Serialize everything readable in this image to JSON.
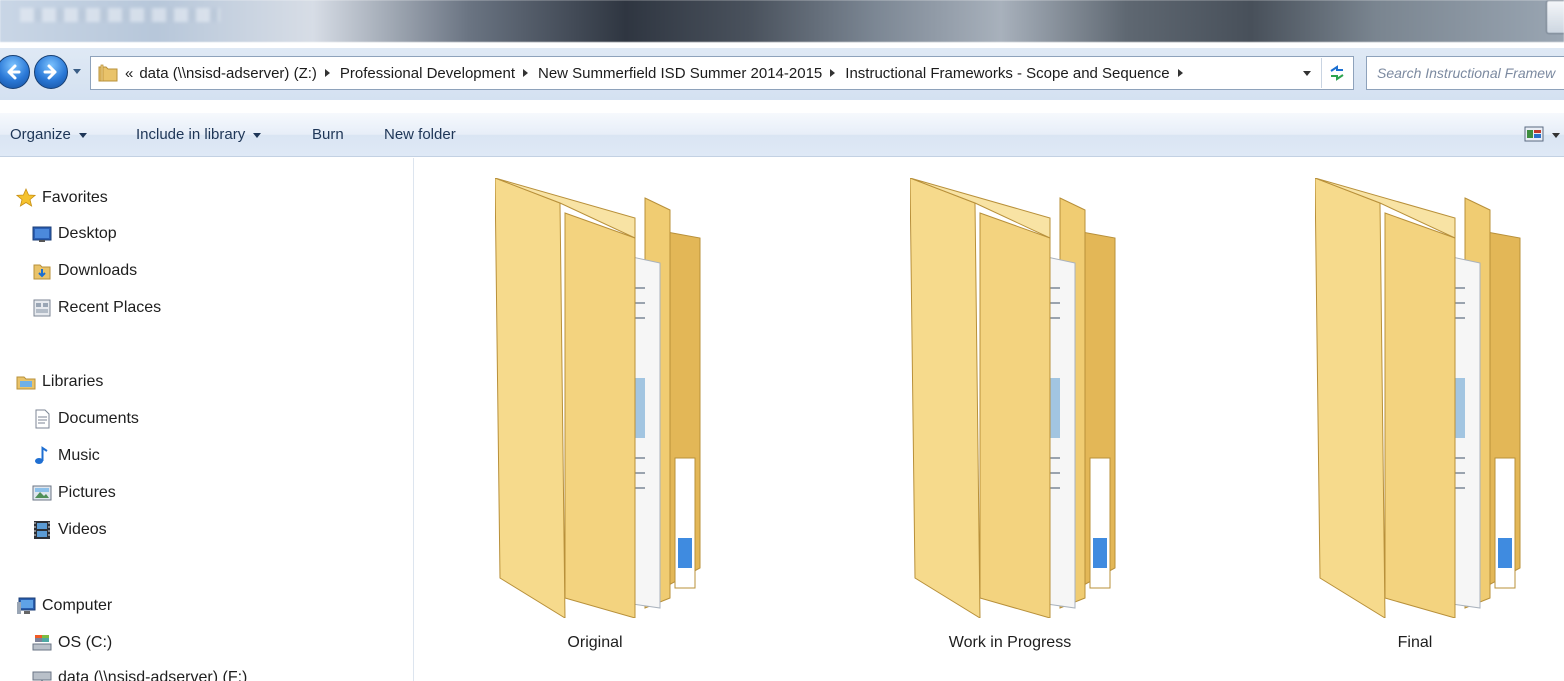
{
  "address_bar": {
    "overflow": "«",
    "crumbs": [
      "data (\\\\nsisd-adserver) (Z:)",
      "Professional Development",
      "New Summerfield ISD Summer 2014-2015",
      "Instructional Frameworks - Scope and Sequence"
    ]
  },
  "search": {
    "placeholder": "Search Instructional Framew"
  },
  "command_bar": {
    "organize": "Organize",
    "include_in_library": "Include in library",
    "burn": "Burn",
    "new_folder": "New folder"
  },
  "navigation": {
    "favorites": {
      "label": "Favorites",
      "items": [
        "Desktop",
        "Downloads",
        "Recent Places"
      ]
    },
    "libraries": {
      "label": "Libraries",
      "items": [
        "Documents",
        "Music",
        "Pictures",
        "Videos"
      ]
    },
    "computer": {
      "label": "Computer",
      "items": [
        "OS (C:)",
        "data (\\\\nsisd-adserver) (F:)"
      ]
    }
  },
  "folders": [
    "Original",
    "Work in Progress",
    "Final"
  ],
  "icons": {
    "back": "back-arrow-icon",
    "forward": "forward-arrow-icon",
    "refresh": "refresh-icon",
    "folder": "folder-icon"
  },
  "colors": {
    "folder_yellow": "#f2d27a",
    "nav_blue": "#2a78d6",
    "command_text": "#1e3657"
  }
}
